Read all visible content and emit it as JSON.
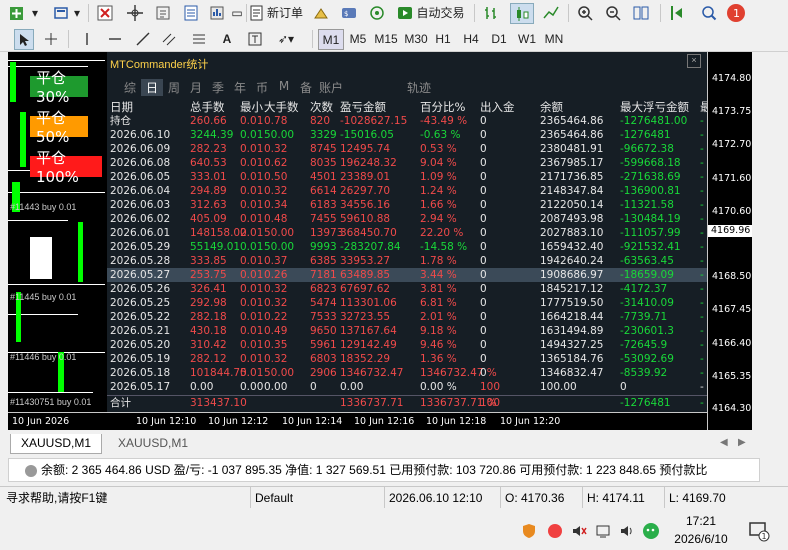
{
  "toolbar": {
    "new_order": "新订单",
    "autotrade": "自动交易",
    "notify_count": "1"
  },
  "timeframes": [
    "M1",
    "M5",
    "M15",
    "M30",
    "H1",
    "H4",
    "D1",
    "W1",
    "MN"
  ],
  "left_buttons": {
    "close30": "平仓30%",
    "close50": "平仓50%",
    "close100": "平仓100%"
  },
  "panel": {
    "title": "MTCommander统计",
    "close_glyph": "×",
    "tabs": [
      "综",
      "日",
      "周",
      "月",
      "季",
      "年",
      "币",
      "M",
      "备"
    ],
    "account_tab": "账户",
    "trail_tab": "轨迹",
    "headers": [
      "日期",
      "总手数",
      "最小",
      "大手数",
      "次数",
      "盈亏金额",
      "百分比%",
      "出入金",
      "余额",
      "最大浮亏金额",
      "最"
    ],
    "rows": [
      {
        "date": "持仓",
        "lots": "260.66",
        "min": "0.01",
        "max": "0.78",
        "count": "820",
        "pnl": "-1028627.15",
        "pct": "-43.49 %",
        "flow": "0",
        "balance": "2365464.86",
        "maxdd": "-1276481.00",
        "c": "n",
        "last": "-"
      },
      {
        "date": "2026.06.10",
        "lots": "3244.39",
        "min": "0.01",
        "max": "50.00",
        "count": "3329",
        "pnl": "-15016.05",
        "pct": "-0.63 %",
        "flow": "0",
        "balance": "2365464.86",
        "maxdd": "-1276481",
        "c": "p",
        "last": "-"
      },
      {
        "date": "2026.06.09",
        "lots": "282.23",
        "min": "0.01",
        "max": "0.32",
        "count": "8745",
        "pnl": "12495.74",
        "pct": "0.53 %",
        "flow": "0",
        "balance": "2380481.91",
        "maxdd": "-96672.38",
        "c": "n",
        "last": "-"
      },
      {
        "date": "2026.06.08",
        "lots": "640.53",
        "min": "0.01",
        "max": "0.62",
        "count": "8035",
        "pnl": "196248.32",
        "pct": "9.04 %",
        "flow": "0",
        "balance": "2367985.17",
        "maxdd": "-599668.18",
        "c": "n",
        "last": "-"
      },
      {
        "date": "2026.06.05",
        "lots": "333.01",
        "min": "0.01",
        "max": "0.50",
        "count": "4501",
        "pnl": "23389.01",
        "pct": "1.09 %",
        "flow": "0",
        "balance": "2171736.85",
        "maxdd": "-271638.69",
        "c": "n",
        "last": "-"
      },
      {
        "date": "2026.06.04",
        "lots": "294.89",
        "min": "0.01",
        "max": "0.32",
        "count": "6614",
        "pnl": "26297.70",
        "pct": "1.24 %",
        "flow": "0",
        "balance": "2148347.84",
        "maxdd": "-136900.81",
        "c": "n",
        "last": "-"
      },
      {
        "date": "2026.06.03",
        "lots": "312.63",
        "min": "0.01",
        "max": "0.34",
        "count": "6183",
        "pnl": "34556.16",
        "pct": "1.66 %",
        "flow": "0",
        "balance": "2122050.14",
        "maxdd": "-11321.58",
        "c": "n",
        "last": "-"
      },
      {
        "date": "2026.06.02",
        "lots": "405.09",
        "min": "0.01",
        "max": "0.48",
        "count": "7455",
        "pnl": "59610.88",
        "pct": "2.94 %",
        "flow": "0",
        "balance": "2087493.98",
        "maxdd": "-130484.19",
        "c": "n",
        "last": "-"
      },
      {
        "date": "2026.06.01",
        "lots": "148158.02",
        "min": "0.01",
        "max": "50.00",
        "count": "13973",
        "pnl": "368450.70",
        "pct": "22.20 %",
        "flow": "0",
        "balance": "2027883.10",
        "maxdd": "-111057.99",
        "c": "n",
        "last": "-"
      },
      {
        "date": "2026.05.29",
        "lots": "55149.01",
        "min": "0.01",
        "max": "50.00",
        "count": "9993",
        "pnl": "-283207.84",
        "pct": "-14.58 %",
        "flow": "0",
        "balance": "1659432.40",
        "maxdd": "-921532.41",
        "c": "p",
        "last": "-"
      },
      {
        "date": "2026.05.28",
        "lots": "333.85",
        "min": "0.01",
        "max": "0.37",
        "count": "6385",
        "pnl": "33953.27",
        "pct": "1.78 %",
        "flow": "0",
        "balance": "1942640.24",
        "maxdd": "-63563.45",
        "c": "n",
        "last": "-"
      },
      {
        "date": "2026.05.27",
        "lots": "253.75",
        "min": "0.01",
        "max": "0.26",
        "count": "7181",
        "pnl": "63489.85",
        "pct": "3.44 %",
        "flow": "0",
        "balance": "1908686.97",
        "maxdd": "-18659.09",
        "c": "n",
        "last": "-",
        "hl": true
      },
      {
        "date": "2026.05.26",
        "lots": "326.41",
        "min": "0.01",
        "max": "0.32",
        "count": "6823",
        "pnl": "67697.62",
        "pct": "3.81 %",
        "flow": "0",
        "balance": "1845217.12",
        "maxdd": "-4172.37",
        "c": "n",
        "last": "-"
      },
      {
        "date": "2026.05.25",
        "lots": "292.98",
        "min": "0.01",
        "max": "0.32",
        "count": "5474",
        "pnl": "113301.06",
        "pct": "6.81 %",
        "flow": "0",
        "balance": "1777519.50",
        "maxdd": "-31410.09",
        "c": "n",
        "last": "-"
      },
      {
        "date": "2026.05.22",
        "lots": "282.18",
        "min": "0.01",
        "max": "0.22",
        "count": "7533",
        "pnl": "32723.55",
        "pct": "2.01 %",
        "flow": "0",
        "balance": "1664218.44",
        "maxdd": "-7739.71",
        "c": "n",
        "last": "-"
      },
      {
        "date": "2026.05.21",
        "lots": "430.18",
        "min": "0.01",
        "max": "0.49",
        "count": "9650",
        "pnl": "137167.64",
        "pct": "9.18 %",
        "flow": "0",
        "balance": "1631494.89",
        "maxdd": "-230601.3",
        "c": "n",
        "last": "-"
      },
      {
        "date": "2026.05.20",
        "lots": "310.42",
        "min": "0.01",
        "max": "0.35",
        "count": "5961",
        "pnl": "129142.49",
        "pct": "9.46 %",
        "flow": "0",
        "balance": "1494327.25",
        "maxdd": "-72645.9",
        "c": "n",
        "last": "-"
      },
      {
        "date": "2026.05.19",
        "lots": "282.12",
        "min": "0.01",
        "max": "0.32",
        "count": "6803",
        "pnl": "18352.29",
        "pct": "1.36 %",
        "flow": "0",
        "balance": "1365184.76",
        "maxdd": "-53092.69",
        "c": "n",
        "last": "-"
      },
      {
        "date": "2026.05.18",
        "lots": "101844.75",
        "min": "0.01",
        "max": "50.00",
        "count": "2906",
        "pnl": "1346732.47",
        "pct": "1346732.47 %",
        "flow": "0",
        "balance": "1346832.47",
        "maxdd": "-8539.92",
        "c": "n",
        "last": "-"
      },
      {
        "date": "2026.05.17",
        "lots": "0.00",
        "min": "0.00",
        "max": "0.00",
        "count": "0",
        "pnl": "0.00",
        "pct": "0.00 %",
        "flow": "100",
        "balance": "100.00",
        "maxdd": "0",
        "c": "w",
        "last": "-"
      }
    ],
    "total": {
      "label": "合计",
      "lots": "313437.10",
      "pnl": "1336737.71",
      "pct": "1336737.71 %",
      "flow": "100",
      "maxdd": "-1276481",
      "last": "-"
    }
  },
  "price_axis": [
    "4174.80",
    "4173.75",
    "4172.70",
    "4171.60",
    "4170.60",
    "4169.96",
    "4168.50",
    "4167.45",
    "4166.40",
    "4165.35",
    "4164.30"
  ],
  "current_price": "4169.96",
  "time_axis": [
    "10 Jun 2026",
    "10 Jun 12:10",
    "10 Jun 12:12",
    "10 Jun 12:14",
    "10 Jun 12:16",
    "10 Jun 12:18",
    "10 Jun 12:20"
  ],
  "strip_labels": [
    "#11443 buy 0.01",
    "#11445 buy 0.01",
    "#11446 buy 0.01",
    "#11430751 buy 0.01"
  ],
  "chart_tabs": [
    "XAUUSD,M1",
    "XAUUSD,M1"
  ],
  "account_bar": "余额: 2 365 464.86 USD  盈/亏: -1 037 895.35  净值: 1 327 569.51  已用预付款: 103 720.86  可用预付款: 1 223 848.65  预付款比",
  "status_bar": {
    "help": "寻求帮助,请按F1键",
    "profile": "Default",
    "datetime": "2026.06.10 12:10",
    "open": "O: 4170.36",
    "high": "H: 4174.11",
    "low": "L: 4169.70"
  },
  "taskbar": {
    "time": "17:21",
    "date": "2026/6/10",
    "notif_count": "1"
  },
  "colors": {
    "panel_bg": "#182028",
    "positive": "#19d839",
    "negative": "#f04a4a",
    "highlight": "#3b4a58"
  }
}
